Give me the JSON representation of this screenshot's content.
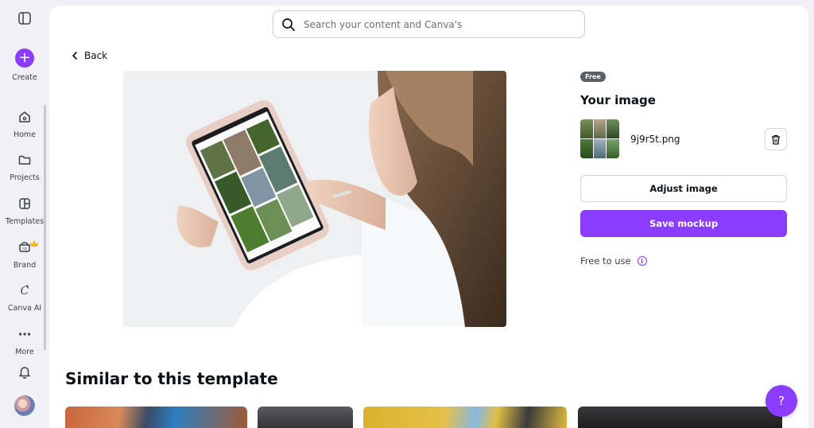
{
  "sidebar": {
    "create_label": "Create",
    "items": [
      {
        "label": "Home",
        "icon": "home-icon"
      },
      {
        "label": "Projects",
        "icon": "folder-icon"
      },
      {
        "label": "Templates",
        "icon": "templates-icon"
      },
      {
        "label": "Brand",
        "icon": "brand-icon"
      },
      {
        "label": "Canva AI",
        "icon": "canva-ai-icon"
      },
      {
        "label": "More",
        "icon": "more-icon"
      }
    ]
  },
  "search": {
    "placeholder": "Search your content and Canva's"
  },
  "nav": {
    "back_label": "Back"
  },
  "details": {
    "badge": "Free",
    "heading": "Your image",
    "filename": "9j9r5t.png",
    "adjust_label": "Adjust image",
    "save_label": "Save mockup",
    "free_to_use": "Free to use"
  },
  "similar": {
    "heading": "Similar to this template"
  },
  "help": {
    "label": "?"
  },
  "colors": {
    "accent": "#8b3dff",
    "background": "#f1f0f7",
    "panel": "#ffffff"
  }
}
